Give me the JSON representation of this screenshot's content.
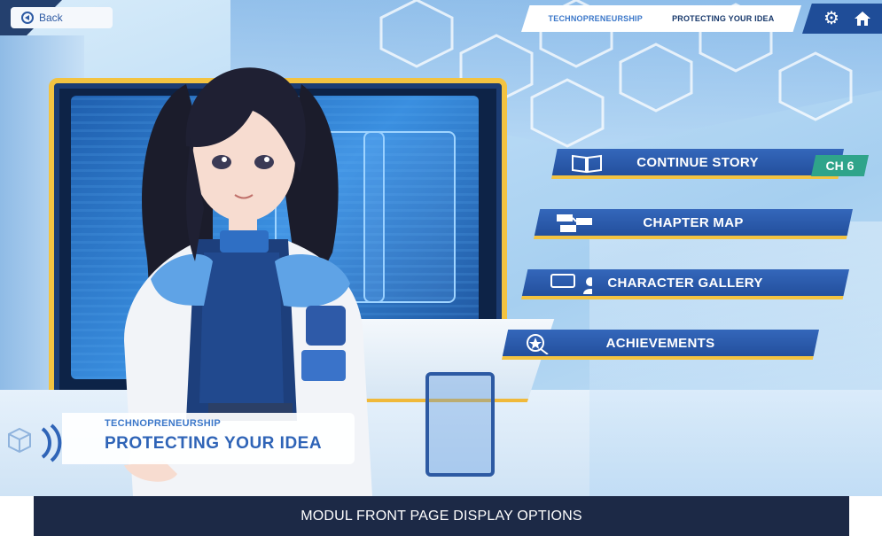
{
  "topbar": {
    "back_label": "Back",
    "breadcrumb": [
      "TECHNOPRENEURSHIP",
      "PROTECTING YOUR IDEA"
    ],
    "icons": [
      "gear-icon",
      "home-icon"
    ]
  },
  "menu": {
    "continue_story": "CONTINUE STORY",
    "chapter_badge": "CH 6",
    "chapter_map": "CHAPTER MAP",
    "character_gallery": "CHARACTER GALLERY",
    "achievements": "ACHIEVEMENTS"
  },
  "title_card": {
    "subtitle": "TECHNOPRENEURSHIP",
    "title": "PROTECTING YOUR IDEA"
  },
  "caption": "MODUL FRONT PAGE DISPLAY OPTIONS",
  "colors": {
    "button_blue": "#2f5fae",
    "button_accent": "#f3c341",
    "badge_green": "#2fa48a",
    "caption_bg": "#1c2946",
    "title_blue": "#2f64b7"
  }
}
